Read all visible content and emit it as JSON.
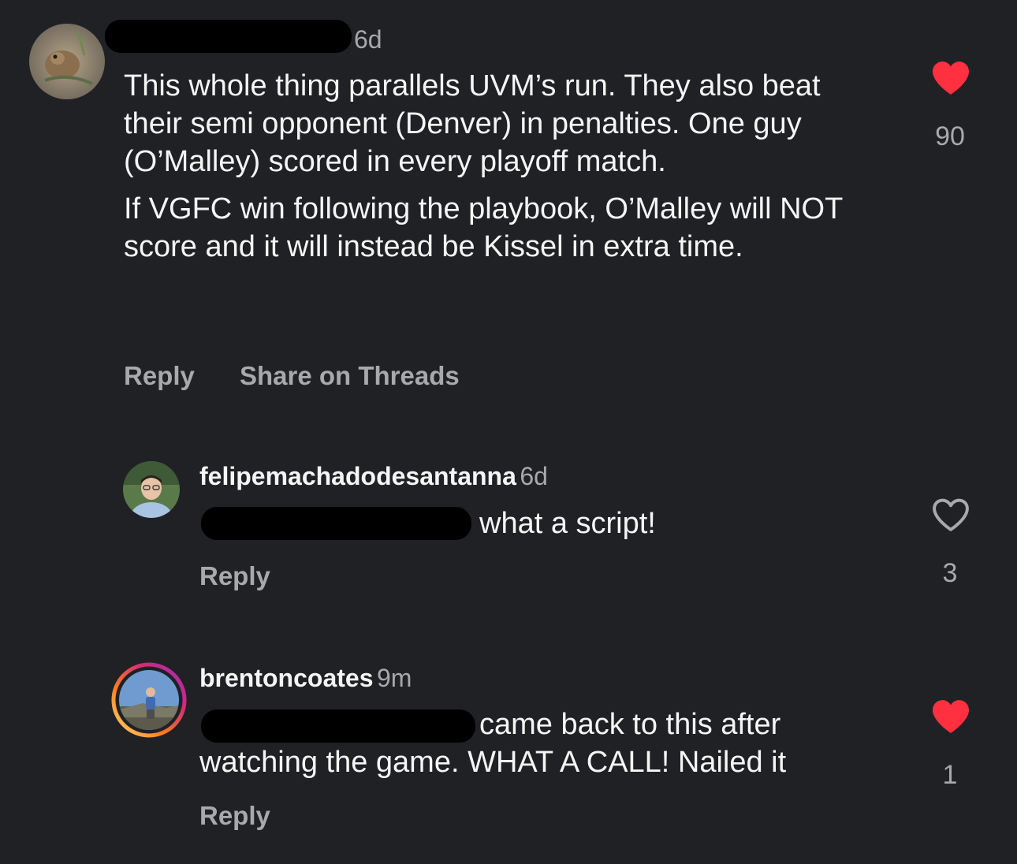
{
  "comments": [
    {
      "timestamp": "6d",
      "paragraphs": [
        "This whole thing parallels UVM’s run. They also beat their semi opponent (Denver) in penalties. One guy (O’Malley) scored in every playoff match.",
        "If VGFC win following the playbook, O’Malley will NOT score and it will instead be Kissel in extra time."
      ],
      "actions": {
        "reply": "Reply",
        "share": "Share on Threads"
      },
      "likes": "90",
      "liked": true
    },
    {
      "username": "felipemachadodesantanna",
      "timestamp": "6d",
      "text": "what a script!",
      "actions": {
        "reply": "Reply"
      },
      "likes": "3",
      "liked": false
    },
    {
      "username": "brentoncoates",
      "timestamp": "9m",
      "text_line1": "came back to this after",
      "text_line2": "watching the game. WHAT A CALL! Nailed it",
      "actions": {
        "reply": "Reply"
      },
      "likes": "1",
      "liked": true
    }
  ],
  "icons": {
    "liked_heart": "heart-filled-icon",
    "unliked_heart": "heart-outline-icon"
  },
  "colors": {
    "background": "#202124",
    "like_red": "#ff3040",
    "muted_text": "#a8a9ad",
    "story_ring": [
      "#feda75",
      "#fa7e1e",
      "#d62976",
      "#962fbf"
    ]
  }
}
